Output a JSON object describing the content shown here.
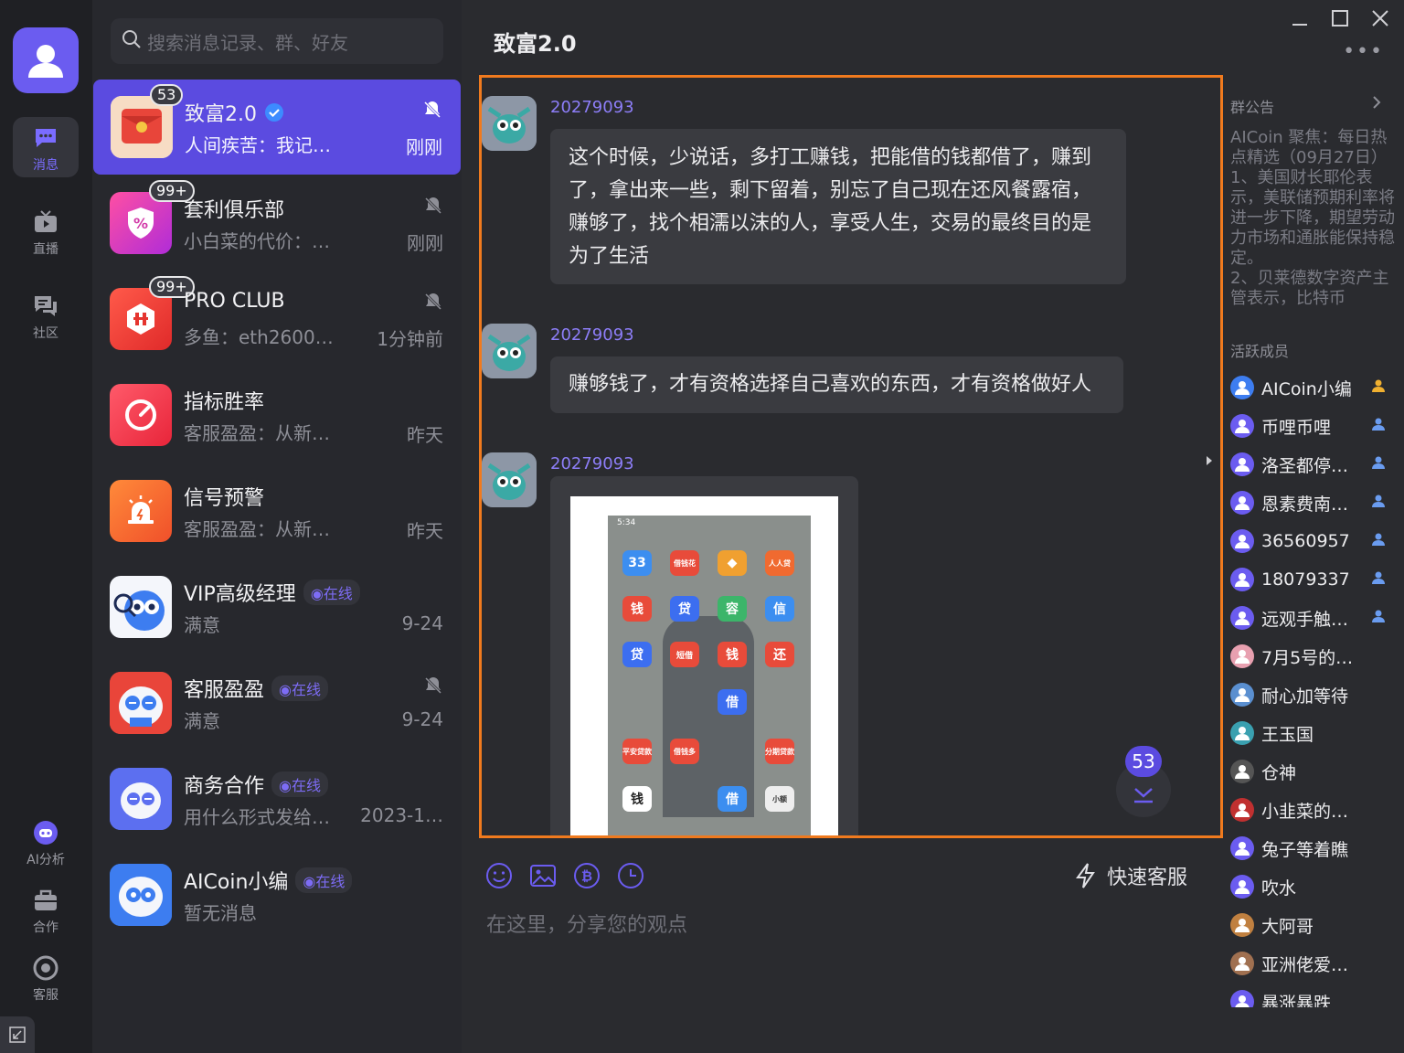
{
  "search": {
    "placeholder": "搜索消息记录、群、好友"
  },
  "rail": {
    "items": [
      {
        "label": "消息"
      },
      {
        "label": "直播"
      },
      {
        "label": "社区"
      },
      {
        "label": "AI分析"
      },
      {
        "label": "合作"
      },
      {
        "label": "客服"
      }
    ]
  },
  "conversations": [
    {
      "name": "致富2.0",
      "preview": "人间疾苦：我记…",
      "time": "刚刚",
      "badge": "53"
    },
    {
      "name": "套利俱乐部",
      "preview": "小白菜的代价：…",
      "time": "刚刚",
      "badge": "99+"
    },
    {
      "name": "PRO CLUB",
      "preview": "多鱼：eth2600…",
      "time": "1分钟前",
      "badge": "99+"
    },
    {
      "name": "指标胜率",
      "preview": "客服盈盈：从新…",
      "time": "昨天"
    },
    {
      "name": "信号预警",
      "preview": "客服盈盈：从新…",
      "time": "昨天"
    },
    {
      "name": "VIP高级经理",
      "status": "◉在线",
      "preview": "满意",
      "time": "9-24"
    },
    {
      "name": "客服盈盈",
      "status": "◉在线",
      "preview": "满意",
      "time": "9-24"
    },
    {
      "name": "商务合作",
      "status": "◉在线",
      "preview": "用什么形式发给…",
      "time": "2023-1…"
    },
    {
      "name": "AICoin小编",
      "status": "◉在线",
      "preview": "暂无消息",
      "time": ""
    }
  ],
  "chat": {
    "title": "致富2.0",
    "messages": [
      {
        "sender": "20279093",
        "lines": [
          "这个时候，少说话，多打工赚钱，把能借的钱都借了，赚到",
          "了，拿出来一些，剩下留着，别忘了自己现在还风餐露宿，",
          "赚够了，找个相濡以沫的人，享受人生，交易的最终目的是",
          "为了生活"
        ]
      },
      {
        "sender": "20279093",
        "lines": [
          "赚够钱了，才有资格选择自己喜欢的东西，才有资格做好人"
        ]
      },
      {
        "sender": "20279093",
        "image": true
      }
    ],
    "phone_status_time": "5:34",
    "phone_icons": [
      "借钱花",
      "人人贷",
      "钱",
      "贷",
      "信",
      "贷",
      "短借",
      "钱",
      "还",
      "借",
      "平安贷款",
      "借钱多",
      "分期贷款",
      "钱",
      "借",
      "小额"
    ],
    "unread_count": "53",
    "input_placeholder": "在这里，分享您的观点",
    "quick_service": "快速客服"
  },
  "side": {
    "notice_title": "群公告",
    "notice_text": "AICoin 聚焦：每日热点精选（09月27日）\n1、美国财长耶伦表示，美联储预期利率将进一步下降，期望劳动力市场和通胀能保持稳定。\n2、贝莱德数字资产主管表示，比特币",
    "members_title": "活跃成员",
    "members": [
      {
        "name": "AICoin小编",
        "role": "owner"
      },
      {
        "name": "币哩币哩",
        "role": "admin"
      },
      {
        "name": "洛圣都停…",
        "role": "admin"
      },
      {
        "name": "恩素费南…",
        "role": "admin"
      },
      {
        "name": "36560957",
        "role": "admin"
      },
      {
        "name": "18079337",
        "role": "admin"
      },
      {
        "name": "远观手触…",
        "role": "admin"
      },
      {
        "name": "7月5号的…",
        "role": ""
      },
      {
        "name": "耐心加等待",
        "role": ""
      },
      {
        "name": "王玉国",
        "role": ""
      },
      {
        "name": "仓神",
        "role": ""
      },
      {
        "name": "小韭菜的…",
        "role": ""
      },
      {
        "name": "兔子等着瞧",
        "role": ""
      },
      {
        "name": "吹水",
        "role": ""
      },
      {
        "name": "大阿哥",
        "role": ""
      },
      {
        "name": "亚洲佬爱…",
        "role": ""
      },
      {
        "name": "暴涨暴跌",
        "role": ""
      }
    ]
  },
  "colors": {
    "accent": "#5b4be0",
    "highlight_frame": "#f07a1e",
    "sender": "#8d7ef8"
  }
}
